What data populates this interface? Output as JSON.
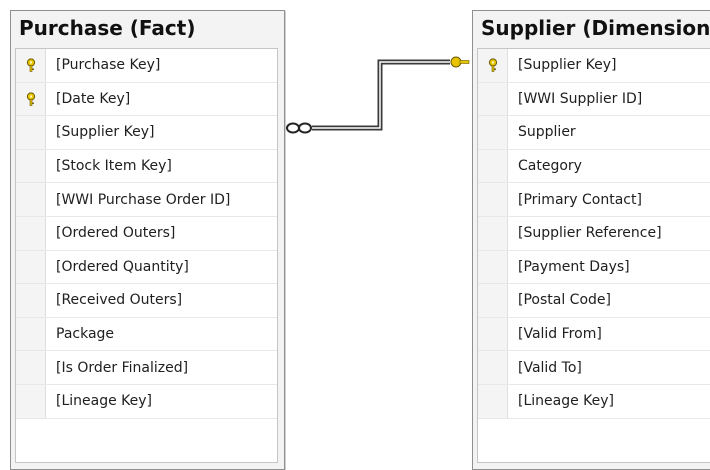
{
  "purchase_table": {
    "title": "Purchase (Fact)",
    "columns": [
      {
        "name": "[Purchase Key]",
        "is_key": true
      },
      {
        "name": "[Date Key]",
        "is_key": true
      },
      {
        "name": "[Supplier Key]",
        "is_key": false
      },
      {
        "name": "[Stock Item Key]",
        "is_key": false
      },
      {
        "name": "[WWI Purchase Order ID]",
        "is_key": false
      },
      {
        "name": "[Ordered Outers]",
        "is_key": false
      },
      {
        "name": "[Ordered Quantity]",
        "is_key": false
      },
      {
        "name": "[Received Outers]",
        "is_key": false
      },
      {
        "name": "Package",
        "is_key": false
      },
      {
        "name": "[Is Order Finalized]",
        "is_key": false
      },
      {
        "name": "[Lineage Key]",
        "is_key": false
      }
    ]
  },
  "supplier_table": {
    "title": "Supplier (Dimension)",
    "columns": [
      {
        "name": "[Supplier Key]",
        "is_key": true
      },
      {
        "name": "[WWI Supplier ID]",
        "is_key": false
      },
      {
        "name": "Supplier",
        "is_key": false
      },
      {
        "name": "Category",
        "is_key": false
      },
      {
        "name": "[Primary Contact]",
        "is_key": false
      },
      {
        "name": "[Supplier Reference]",
        "is_key": false
      },
      {
        "name": "[Payment Days]",
        "is_key": false
      },
      {
        "name": "[Postal Code]",
        "is_key": false
      },
      {
        "name": "[Valid From]",
        "is_key": false
      },
      {
        "name": "[Valid To]",
        "is_key": false
      },
      {
        "name": "[Lineage Key]",
        "is_key": false
      }
    ]
  },
  "relationship": {
    "from": "Purchase (Fact)",
    "to": "Supplier (Dimension)",
    "many_end_icon": "infinity-icon",
    "one_end_icon": "key-icon",
    "line_color": "#3a3a3a",
    "key_color": "#e8c400"
  },
  "colors": {
    "key_icon": "#e8c400",
    "title_bar": "#f3f3f3",
    "border": "#8f8f8f"
  }
}
